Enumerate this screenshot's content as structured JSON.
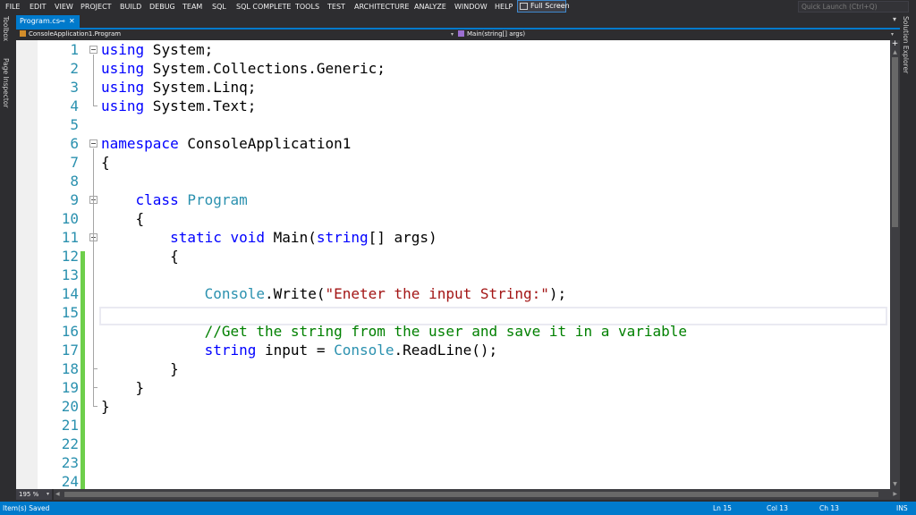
{
  "menu": {
    "items": [
      {
        "key": "file",
        "label": "FILE"
      },
      {
        "key": "edit",
        "label": "EDIT"
      },
      {
        "key": "view",
        "label": "VIEW"
      },
      {
        "key": "project",
        "label": "PROJECT"
      },
      {
        "key": "build",
        "label": "BUILD"
      },
      {
        "key": "debug",
        "label": "DEBUG"
      },
      {
        "key": "team",
        "label": "TEAM"
      },
      {
        "key": "sql",
        "label": "SQL"
      },
      {
        "key": "sql-complete",
        "label": "SQL COMPLETE"
      },
      {
        "key": "tools",
        "label": "TOOLS"
      },
      {
        "key": "test",
        "label": "TEST"
      },
      {
        "key": "architecture",
        "label": "ARCHITECTURE"
      },
      {
        "key": "analyze",
        "label": "ANALYZE"
      },
      {
        "key": "window",
        "label": "WINDOW"
      },
      {
        "key": "help",
        "label": "HELP"
      }
    ],
    "fullscreen_label": "Full Screen",
    "quick_launch_placeholder": "Quick Launch (Ctrl+Q)"
  },
  "left_strip": {
    "toolbox": "Toolbox",
    "page_inspector": "Page Inspector"
  },
  "right_strip": {
    "solution_explorer": "Solution Explorer"
  },
  "tab": {
    "label": "Program.cs",
    "pin_icon": "pin-icon",
    "close_icon": "close-icon"
  },
  "navbar": {
    "class_combo": "ConsoleApplication1.Program",
    "member_combo": "Main(string[] args)"
  },
  "code": {
    "lines": [
      {
        "n": "1",
        "tokens": [
          {
            "t": "using",
            "c": "kw"
          },
          {
            "t": " System;",
            "c": ""
          }
        ]
      },
      {
        "n": "2",
        "tokens": [
          {
            "t": "using",
            "c": "kw"
          },
          {
            "t": " System.Collections.Generic;",
            "c": ""
          }
        ]
      },
      {
        "n": "3",
        "tokens": [
          {
            "t": "using",
            "c": "kw"
          },
          {
            "t": " System.Linq;",
            "c": ""
          }
        ]
      },
      {
        "n": "4",
        "tokens": [
          {
            "t": "using",
            "c": "kw"
          },
          {
            "t": " System.Text;",
            "c": ""
          }
        ]
      },
      {
        "n": "5",
        "tokens": []
      },
      {
        "n": "6",
        "tokens": [
          {
            "t": "namespace",
            "c": "kw"
          },
          {
            "t": " ConsoleApplication1",
            "c": ""
          }
        ]
      },
      {
        "n": "7",
        "tokens": [
          {
            "t": "{",
            "c": ""
          }
        ]
      },
      {
        "n": "8",
        "tokens": []
      },
      {
        "n": "9",
        "tokens": [
          {
            "t": "    ",
            "c": ""
          },
          {
            "t": "class",
            "c": "kw"
          },
          {
            "t": " ",
            "c": ""
          },
          {
            "t": "Program",
            "c": "ty"
          }
        ]
      },
      {
        "n": "10",
        "tokens": [
          {
            "t": "    {",
            "c": ""
          }
        ]
      },
      {
        "n": "11",
        "tokens": [
          {
            "t": "        ",
            "c": ""
          },
          {
            "t": "static",
            "c": "kw"
          },
          {
            "t": " ",
            "c": ""
          },
          {
            "t": "void",
            "c": "kw"
          },
          {
            "t": " Main(",
            "c": ""
          },
          {
            "t": "string",
            "c": "kw"
          },
          {
            "t": "[] args)",
            "c": ""
          }
        ]
      },
      {
        "n": "12",
        "tokens": [
          {
            "t": "        {",
            "c": ""
          }
        ]
      },
      {
        "n": "13",
        "tokens": []
      },
      {
        "n": "14",
        "tokens": [
          {
            "t": "            ",
            "c": ""
          },
          {
            "t": "Console",
            "c": "ty"
          },
          {
            "t": ".Write(",
            "c": ""
          },
          {
            "t": "\"Eneter the input String:\"",
            "c": "str"
          },
          {
            "t": ");",
            "c": ""
          }
        ]
      },
      {
        "n": "15",
        "tokens": []
      },
      {
        "n": "16",
        "tokens": [
          {
            "t": "            ",
            "c": ""
          },
          {
            "t": "//Get the string from the user and save it in a variable",
            "c": "cm"
          }
        ]
      },
      {
        "n": "17",
        "tokens": [
          {
            "t": "            ",
            "c": ""
          },
          {
            "t": "string",
            "c": "kw"
          },
          {
            "t": " input = ",
            "c": ""
          },
          {
            "t": "Console",
            "c": "ty"
          },
          {
            "t": ".ReadLine();",
            "c": ""
          }
        ]
      },
      {
        "n": "18",
        "tokens": [
          {
            "t": "        }",
            "c": ""
          }
        ]
      },
      {
        "n": "19",
        "tokens": [
          {
            "t": "    }",
            "c": ""
          }
        ]
      },
      {
        "n": "20",
        "tokens": [
          {
            "t": "}",
            "c": ""
          }
        ]
      },
      {
        "n": "21",
        "tokens": []
      },
      {
        "n": "22",
        "tokens": []
      },
      {
        "n": "23",
        "tokens": []
      },
      {
        "n": "24",
        "tokens": []
      }
    ],
    "collapsible_lines": [
      "1",
      "6",
      "9",
      "11"
    ],
    "current_line": "15",
    "colors": {
      "keyword": "#0000ff",
      "type": "#2b91af",
      "string": "#a31515",
      "comment": "#008000",
      "line_number": "#2b91af",
      "changed_margin": "#6ecf4b"
    }
  },
  "zoom": {
    "value": "195 %"
  },
  "status": {
    "message": "Item(s) Saved",
    "line": "Ln 15",
    "col": "Col 13",
    "ch": "Ch 13",
    "mode": "INS",
    "accent": "#007acc"
  }
}
